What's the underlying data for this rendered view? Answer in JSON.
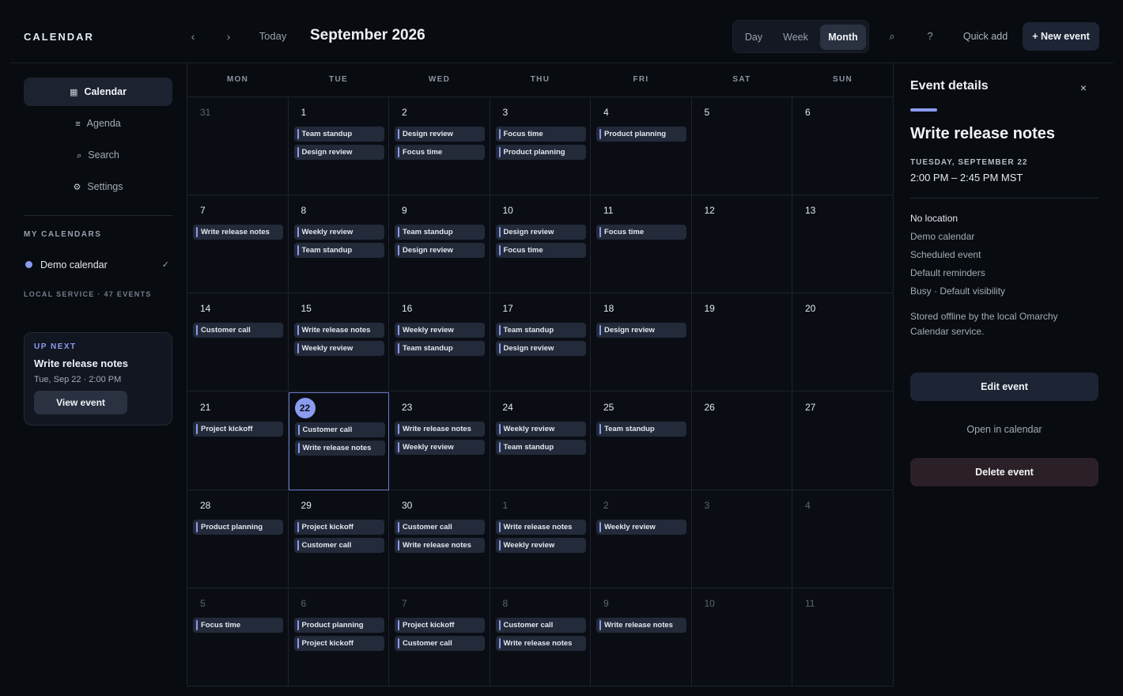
{
  "app": {
    "brand": "CALENDAR",
    "prev_icon": "‹",
    "next_icon": "›",
    "today_label": "Today",
    "month_title": "September 2026",
    "views": [
      {
        "label": "Day",
        "active": false
      },
      {
        "label": "Week",
        "active": false
      },
      {
        "label": "Month",
        "active": true
      }
    ],
    "search_icon": "⌕",
    "help_icon": "?",
    "quick_add_label": "Quick add",
    "new_event_label": "+  New event"
  },
  "sidebar": {
    "items": [
      {
        "icon": "▦",
        "icon_name": "calendar-grid-icon",
        "label": "Calendar",
        "active": true
      },
      {
        "icon": "≡",
        "icon_name": "agenda-list-icon",
        "label": "Agenda",
        "active": false
      },
      {
        "icon": "⌕",
        "icon_name": "search-icon",
        "label": "Search",
        "active": false
      },
      {
        "icon": "⚙",
        "icon_name": "gear-icon",
        "label": "Settings",
        "active": false
      }
    ],
    "my_calendars_heading": "MY CALENDARS",
    "calendars": [
      {
        "name": "Demo calendar",
        "color": "#8b9bf0",
        "checked": "✓"
      }
    ],
    "service_line": "LOCAL SERVICE  ·  47 EVENTS",
    "up_next": {
      "label": "UP NEXT",
      "title": "Write release notes",
      "time": "Tue, Sep 22 · 2:00 PM",
      "button": "View event"
    }
  },
  "calendar": {
    "weekdays": [
      "MON",
      "TUE",
      "WED",
      "THU",
      "FRI",
      "SAT",
      "SUN"
    ],
    "weeks": [
      [
        {
          "day": "31",
          "outside": true,
          "events": []
        },
        {
          "day": "1",
          "events": [
            "Team standup",
            "Design review"
          ]
        },
        {
          "day": "2",
          "events": [
            "Design review",
            "Focus time"
          ]
        },
        {
          "day": "3",
          "events": [
            "Focus time",
            "Product planning"
          ]
        },
        {
          "day": "4",
          "events": [
            "Product planning"
          ]
        },
        {
          "day": "5",
          "events": []
        },
        {
          "day": "6",
          "events": []
        }
      ],
      [
        {
          "day": "7",
          "events": [
            "Write release notes"
          ]
        },
        {
          "day": "8",
          "events": [
            "Weekly review",
            "Team standup"
          ]
        },
        {
          "day": "9",
          "events": [
            "Team standup",
            "Design review"
          ]
        },
        {
          "day": "10",
          "events": [
            "Design review",
            "Focus time"
          ]
        },
        {
          "day": "11",
          "events": [
            "Focus time"
          ]
        },
        {
          "day": "12",
          "events": []
        },
        {
          "day": "13",
          "events": []
        }
      ],
      [
        {
          "day": "14",
          "events": [
            "Customer call"
          ]
        },
        {
          "day": "15",
          "events": [
            "Write release notes",
            "Weekly review"
          ]
        },
        {
          "day": "16",
          "events": [
            "Weekly review",
            "Team standup"
          ]
        },
        {
          "day": "17",
          "events": [
            "Team standup",
            "Design review"
          ]
        },
        {
          "day": "18",
          "events": [
            "Design review"
          ]
        },
        {
          "day": "19",
          "events": []
        },
        {
          "day": "20",
          "events": []
        }
      ],
      [
        {
          "day": "21",
          "events": [
            "Project kickoff"
          ]
        },
        {
          "day": "22",
          "selected": true,
          "events": [
            "Customer call",
            "Write release notes"
          ]
        },
        {
          "day": "23",
          "events": [
            "Write release notes",
            "Weekly review"
          ]
        },
        {
          "day": "24",
          "events": [
            "Weekly review",
            "Team standup"
          ]
        },
        {
          "day": "25",
          "events": [
            "Team standup"
          ]
        },
        {
          "day": "26",
          "events": []
        },
        {
          "day": "27",
          "events": []
        }
      ],
      [
        {
          "day": "28",
          "events": [
            "Product planning"
          ]
        },
        {
          "day": "29",
          "events": [
            "Project kickoff",
            "Customer call"
          ]
        },
        {
          "day": "30",
          "events": [
            "Customer call",
            "Write release notes"
          ]
        },
        {
          "day": "1",
          "outside": true,
          "events": [
            "Write release notes",
            "Weekly review"
          ]
        },
        {
          "day": "2",
          "outside": true,
          "events": [
            "Weekly review"
          ]
        },
        {
          "day": "3",
          "outside": true,
          "events": []
        },
        {
          "day": "4",
          "outside": true,
          "events": []
        }
      ],
      [
        {
          "day": "5",
          "outside": true,
          "events": [
            "Focus time"
          ]
        },
        {
          "day": "6",
          "outside": true,
          "events": [
            "Product planning",
            "Project kickoff"
          ]
        },
        {
          "day": "7",
          "outside": true,
          "events": [
            "Project kickoff",
            "Customer call"
          ]
        },
        {
          "day": "8",
          "outside": true,
          "events": [
            "Customer call",
            "Write release notes"
          ]
        },
        {
          "day": "9",
          "outside": true,
          "events": [
            "Write release notes"
          ]
        },
        {
          "day": "10",
          "outside": true,
          "events": []
        },
        {
          "day": "11",
          "outside": true,
          "events": []
        }
      ]
    ]
  },
  "details": {
    "heading": "Event details",
    "close_icon": "×",
    "title": "Write release notes",
    "date": "TUESDAY, SEPTEMBER 22",
    "time": "2:00 PM – 2:45 PM  MST",
    "lines": [
      "No location",
      "Demo calendar",
      "Scheduled event",
      "Default reminders",
      "Busy · Default visibility"
    ],
    "note": "Stored offline by the local Omarchy Calendar service.",
    "edit_button": "Edit event",
    "open_button": "Open in calendar",
    "delete_button": "Delete event"
  },
  "colors": {
    "accent": "#8b9bf0",
    "background": "#080b10",
    "event_chip": "#232a3a",
    "delete_button": "#2b2028"
  }
}
